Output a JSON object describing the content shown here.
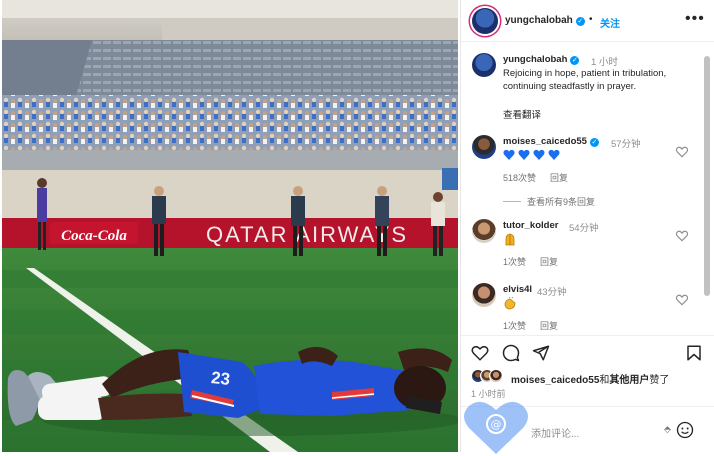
{
  "post": {
    "username": "yungchalobah",
    "verified_mark": "✓",
    "separator": "•",
    "follow_label": "关注",
    "more_icon": "more-horizontal-icon",
    "caption_time": "1 小时",
    "caption": "Rejoicing in hope, patient in tribulation, continuing steadfastly in prayer.",
    "see_translation": "查看翻译"
  },
  "photo": {
    "ad_boards": [
      "Coca-Cola",
      "QATAR AIRWAYS"
    ],
    "jersey_number": "23",
    "colors": {
      "pitch": "#2f7a36",
      "kit": "#1f4fd1",
      "board": "#b5122b"
    }
  },
  "comments": [
    {
      "user": "moises_caicedo55",
      "verified": true,
      "time": "57分钟",
      "body_emoji": "blue-heart x4",
      "likes": "518次赞",
      "reply_label": "回复",
      "view_replies": "查看所有9条回复"
    },
    {
      "user": "tutor_kolder",
      "verified": false,
      "time": "54分钟",
      "body_emoji": "folded-hands-icon",
      "likes": "1次赞",
      "reply_label": "回复"
    },
    {
      "user": "elvis4l",
      "verified": false,
      "time": "43分钟",
      "body_emoji": "clapping-hands-icon",
      "likes": "1次赞",
      "reply_label": "回复"
    }
  ],
  "actions": {
    "likes_user": "moises_caicedo55",
    "likes_middle": "和",
    "likes_others": "其他用户",
    "likes_suffix": "赞了",
    "post_time": "1 小时前",
    "comment_placeholder": "添加评论...",
    "composer_misc": "⬘"
  },
  "colors": {
    "accent": "#0095f6",
    "heart_emoji": "#1a6ef0",
    "text": "#262626",
    "muted": "#8e8e8e"
  }
}
